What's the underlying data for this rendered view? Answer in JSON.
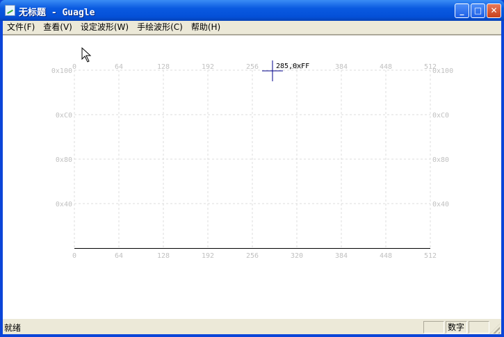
{
  "window": {
    "title": "无标题 - Guagle",
    "minimize": "0",
    "maximize": "1",
    "close": "r"
  },
  "menu": [
    "文件(F)",
    "查看(V)",
    "设定波形(W)",
    "手绘波形(C)",
    "帮助(H)"
  ],
  "plot": {
    "x_ticks": [
      "0",
      "64",
      "128",
      "192",
      "256",
      "320",
      "384",
      "448",
      "512"
    ],
    "y_ticks": [
      "0x100",
      "0xC0",
      "0x80",
      "0x40"
    ],
    "x_range": [
      0,
      512
    ],
    "y_range": [
      0,
      256
    ],
    "cursor": {
      "x": 285,
      "y": 255,
      "label": "285,0xFF"
    },
    "colors": {
      "grid": "#dcdcdc",
      "tick": "#c0c0c0",
      "cursor": "#00008b",
      "baseline": "#000000"
    }
  },
  "status": {
    "text": "就绪",
    "pane2": "数字"
  }
}
